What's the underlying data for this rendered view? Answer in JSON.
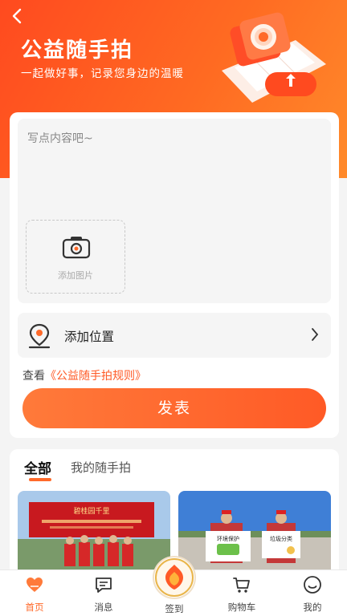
{
  "header": {
    "title": "公益随手拍",
    "subtitle": "一起做好事，记录您身边的温暖"
  },
  "compose": {
    "placeholder": "写点内容吧~",
    "add_photo_label": "添加图片",
    "add_location_label": "添加位置",
    "rules_prefix": "查看",
    "rules_link": "《公益随手拍规则》",
    "publish_label": "发表"
  },
  "feed": {
    "tabs": [
      {
        "label": "全部",
        "active": true
      },
      {
        "label": "我的随手拍",
        "active": false
      }
    ],
    "photo1_banner": "碧桂园千里",
    "photo2_sign_a": "环境保护",
    "photo2_sign_b": "垃圾分类"
  },
  "tabbar": {
    "items": [
      {
        "label": "首页",
        "icon": "heart-icon",
        "active": true
      },
      {
        "label": "消息",
        "icon": "message-icon",
        "active": false
      },
      {
        "label": "签到",
        "icon": "signin-badge-icon",
        "active": false
      },
      {
        "label": "购物车",
        "icon": "cart-icon",
        "active": false
      },
      {
        "label": "我的",
        "icon": "profile-icon",
        "active": false
      }
    ]
  },
  "colors": {
    "accent": "#ff5a26",
    "header_gradient_start": "#ff4a1f",
    "header_gradient_end": "#ff8a2a"
  }
}
